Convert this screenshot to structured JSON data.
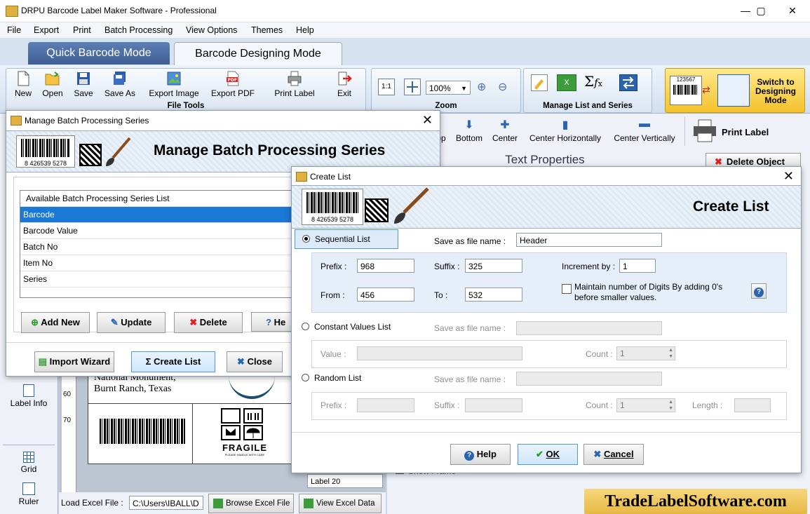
{
  "window": {
    "title": "DRPU Barcode Label Maker Software - Professional",
    "minimize": "—",
    "maximize": "▢",
    "close": "✕"
  },
  "menu": [
    "File",
    "Export",
    "Print",
    "Batch Processing",
    "View Options",
    "Themes",
    "Help"
  ],
  "mode_tabs": {
    "quick": "Quick Barcode Mode",
    "designing": "Barcode Designing Mode"
  },
  "file_tools": {
    "group_label": "File Tools",
    "buttons": [
      "New",
      "Open",
      "Save",
      "Save As",
      "Export Image",
      "Export PDF",
      "Print Label",
      "Exit"
    ]
  },
  "zoom": {
    "group_label": "Zoom",
    "value": "100%"
  },
  "manage_list": {
    "group_label": "Manage List and Series"
  },
  "switch_button": {
    "label": "Switch to Designing Mode",
    "sample_number": "123567"
  },
  "align_toolbar": [
    "op",
    "Bottom",
    "Center",
    "Center Horizontally",
    "Center Vertically"
  ],
  "print_label_button": "Print Label",
  "text_properties": "Text Properties",
  "delete_object": "Delete Object",
  "sidebar": {
    "label_info": "Label Info",
    "grid": "Grid",
    "ruler": "Ruler"
  },
  "ruler_marks": [
    "60",
    "70"
  ],
  "label_preview": {
    "line1": "National Monument,",
    "line2": "Burnt Ranch, Texas",
    "fragile": "FRAGILE",
    "fragile_sub": "PLEASE HANDLE WITH CARE",
    "label_list_item": "Label 20"
  },
  "load_excel": {
    "label": "Load Excel File :",
    "path": "C:\\Users\\IBALL\\D",
    "browse": "Browse Excel File",
    "view": "View Excel Data"
  },
  "right_bottom": {
    "show_frame": "Show Frame"
  },
  "brand": "TradeLabelSoftware.com",
  "batch_dialog": {
    "title": "Manage Batch Processing Series",
    "banner": "Manage Batch Processing Series",
    "barcode_number": "8 426539 5278",
    "list_header": "Available Batch Processing Series List",
    "items": [
      "Barcode",
      "Barcode Value",
      "Batch No",
      "Item No",
      "Series"
    ],
    "buttons": [
      "Add New",
      "Update",
      "Delete",
      "He"
    ],
    "footer_buttons": [
      "Import Wizard",
      "Create List",
      "Close"
    ]
  },
  "create_dialog": {
    "title": "Create List",
    "banner": "Create List",
    "barcode_number": "8 426539 5278",
    "sequential": {
      "label": "Sequential List",
      "save_label": "Save as file name :",
      "save_value": "Header",
      "prefix_label": "Prefix :",
      "prefix_value": "968",
      "suffix_label": "Suffix :",
      "suffix_value": "325",
      "increment_label": "Increment by :",
      "increment_value": "1",
      "from_label": "From :",
      "from_value": "456",
      "to_label": "To :",
      "to_value": "532",
      "maintain_label": "Maintain number of Digits By adding 0's before smaller values.",
      "help_icon": "?"
    },
    "constant": {
      "label": "Constant Values List",
      "save_label": "Save as file name :",
      "value_label": "Value :",
      "count_label": "Count :",
      "count_value": "1"
    },
    "random": {
      "label": "Random List",
      "save_label": "Save as file name :",
      "prefix_label": "Prefix :",
      "suffix_label": "Suffix :",
      "count_label": "Count :",
      "count_value": "1",
      "length_label": "Length :"
    },
    "buttons": {
      "help": "Help",
      "ok": "OK",
      "cancel": "Cancel"
    }
  }
}
